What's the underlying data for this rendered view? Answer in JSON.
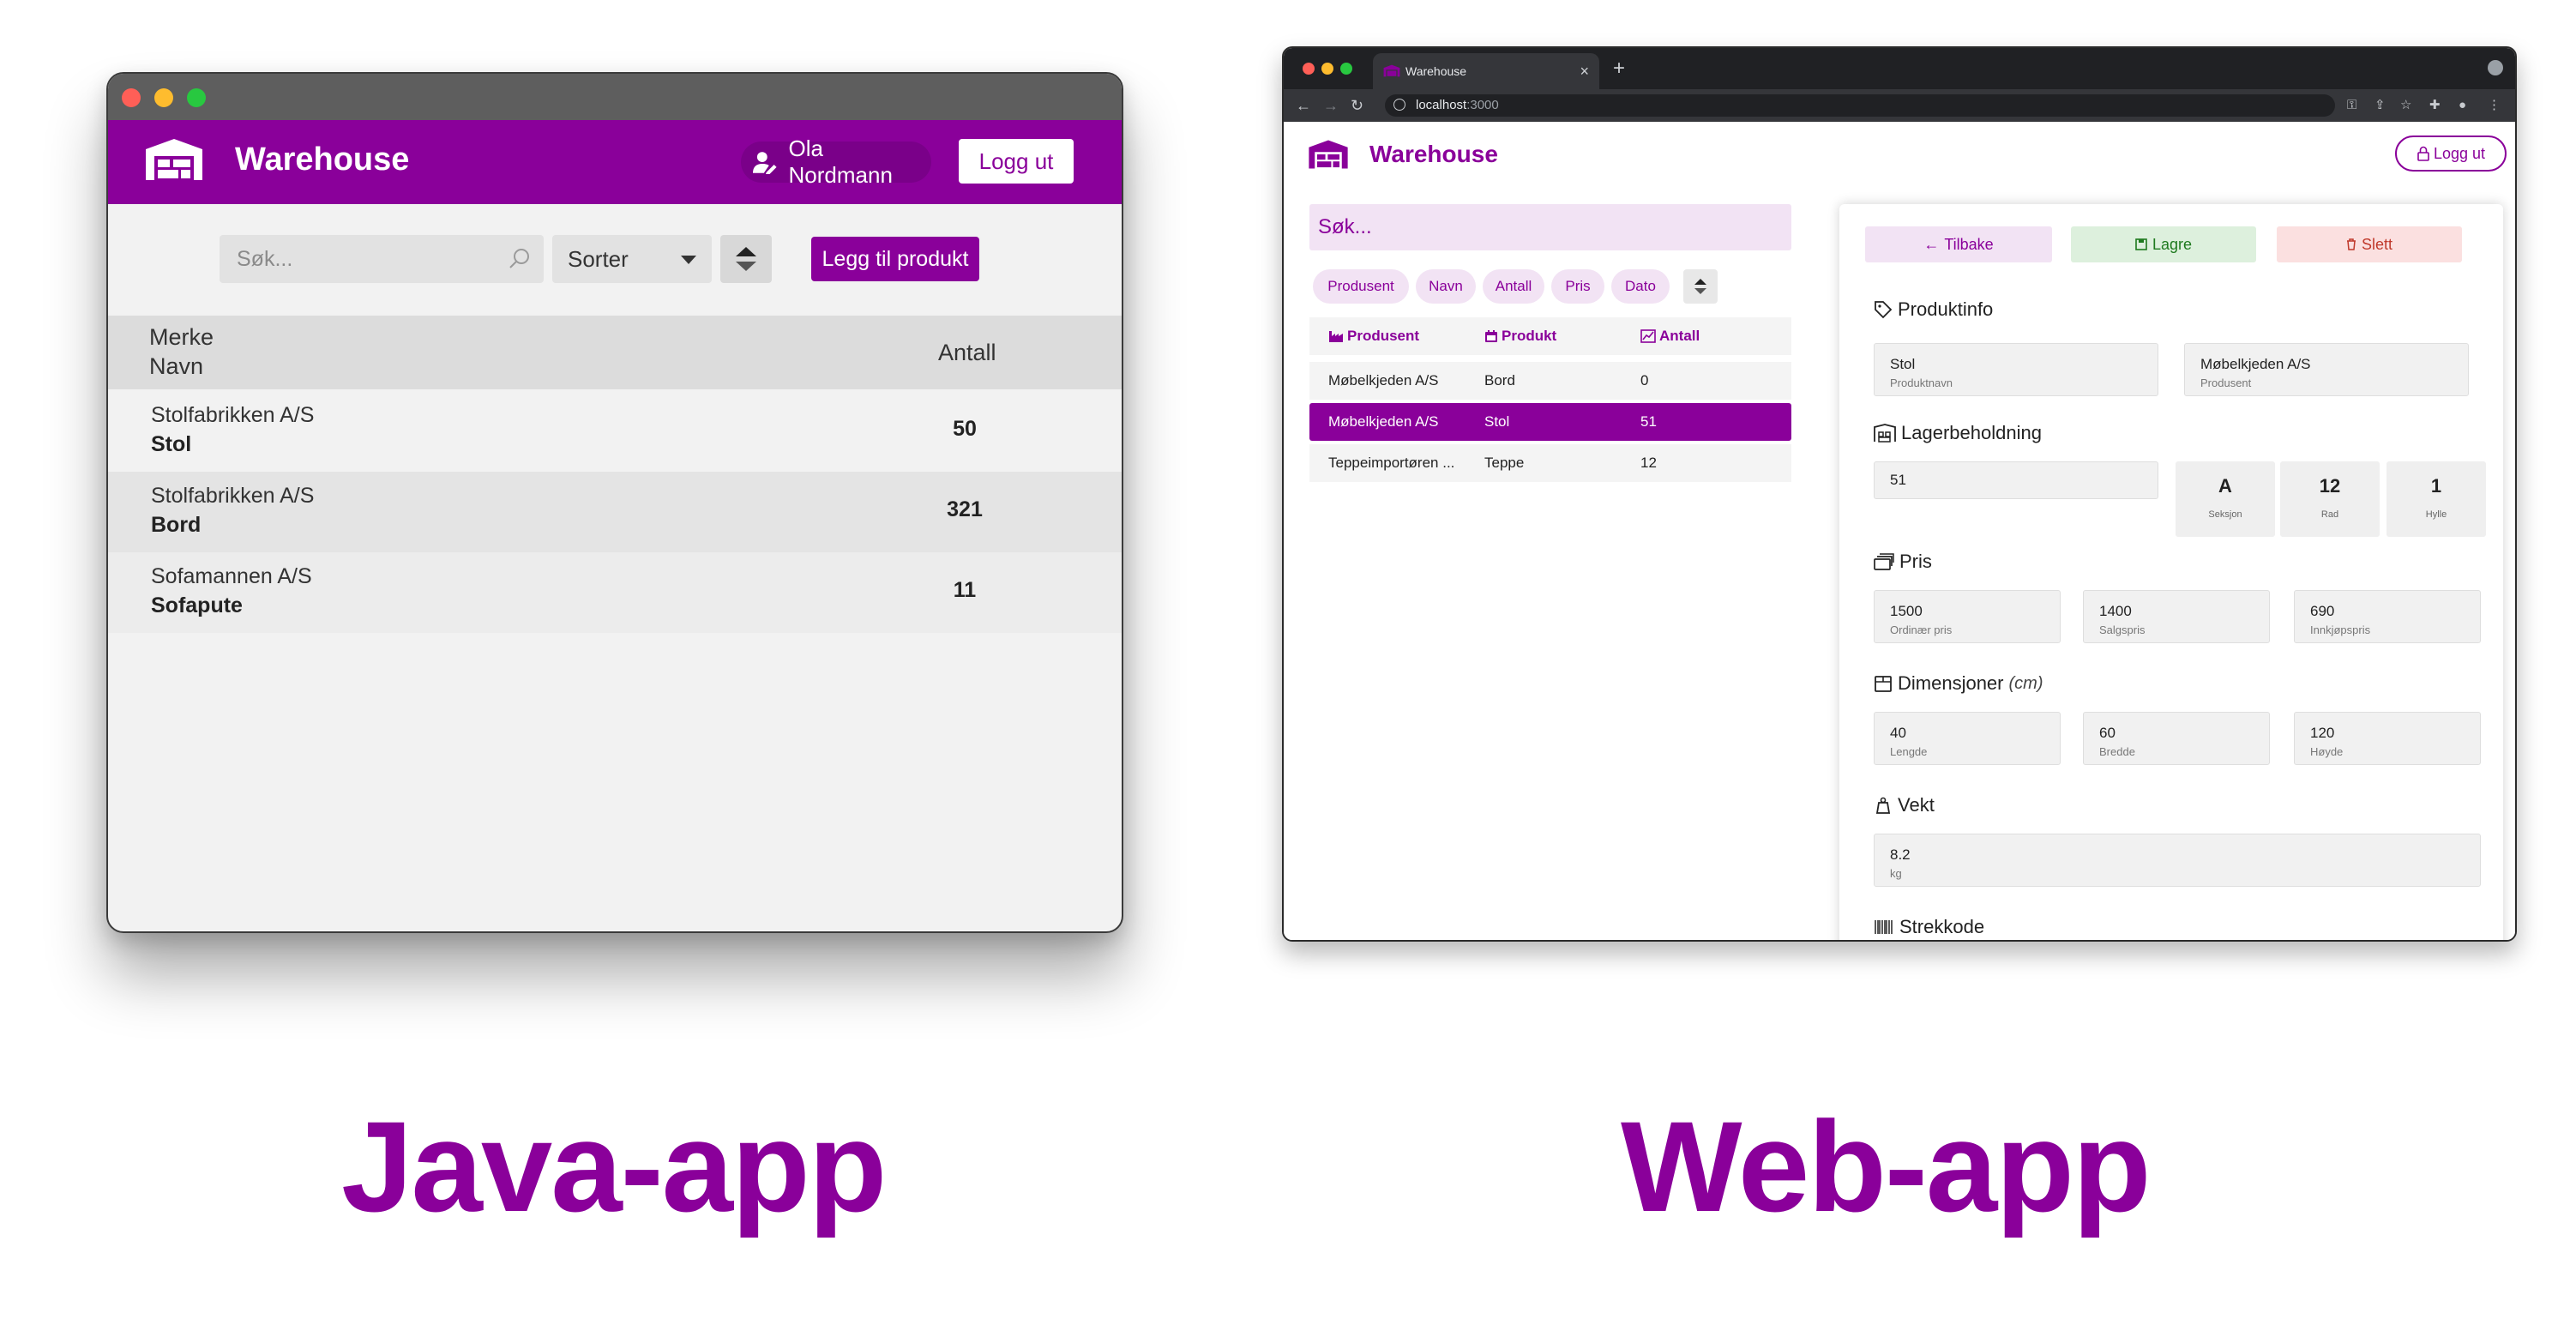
{
  "captions": {
    "left": "Java-app",
    "right": "Web-app"
  },
  "colors": {
    "accent": "#8a009a",
    "accent_light": "#f2e3f4",
    "save_green": "#1f7a1f",
    "delete_red": "#c0392b"
  },
  "java_app": {
    "title": "Warehouse",
    "user": "Ola Nordmann",
    "logout": "Logg ut",
    "search_placeholder": "Søk...",
    "sort_label": "Sorter",
    "add_product": "Legg til produkt",
    "columns": {
      "brand": "Merke",
      "name": "Navn",
      "qty": "Antall"
    },
    "rows": [
      {
        "brand": "Stolfabrikken A/S",
        "name": "Stol",
        "qty": "50"
      },
      {
        "brand": "Stolfabrikken A/S",
        "name": "Bord",
        "qty": "321"
      },
      {
        "brand": "Sofamannen A/S",
        "name": "Sofapute",
        "qty": "11"
      }
    ]
  },
  "browser": {
    "tab_title": "Warehouse",
    "url_host": "localhost",
    "url_port": ":3000"
  },
  "web_app": {
    "title": "Warehouse",
    "logout": "Logg ut",
    "search_placeholder": "Søk...",
    "chips": [
      "Produsent",
      "Navn",
      "Antall",
      "Pris",
      "Dato"
    ],
    "columns": {
      "producer": "Produsent",
      "product": "Produkt",
      "qty": "Antall"
    },
    "rows": [
      {
        "producer": "Møbelkjeden A/S",
        "product": "Bord",
        "qty": "0"
      },
      {
        "producer": "Møbelkjeden A/S",
        "product": "Stol",
        "qty": "51"
      },
      {
        "producer": "Teppeimportøren ...",
        "product": "Teppe",
        "qty": "12"
      }
    ],
    "selected_row": 1,
    "detail": {
      "back": "Tilbake",
      "save": "Lagre",
      "delete": "Slett",
      "product_info": {
        "heading": "Produktinfo",
        "name": {
          "value": "Stol",
          "label": "Produktnavn"
        },
        "producer": {
          "value": "Møbelkjeden A/S",
          "label": "Produsent"
        }
      },
      "stock": {
        "heading": "Lagerbeholdning",
        "value": "51",
        "section": {
          "value": "A",
          "label": "Seksjon"
        },
        "row": {
          "value": "12",
          "label": "Rad"
        },
        "shelf": {
          "value": "1",
          "label": "Hylle"
        }
      },
      "price": {
        "heading": "Pris",
        "regular": {
          "value": "1500",
          "label": "Ordinær pris"
        },
        "sale": {
          "value": "1400",
          "label": "Salgspris"
        },
        "purchase": {
          "value": "690",
          "label": "Innkjøpspris"
        }
      },
      "dimensions": {
        "heading": "Dimensjoner",
        "unit": "(cm)",
        "length": {
          "value": "40",
          "label": "Lengde"
        },
        "width": {
          "value": "60",
          "label": "Bredde"
        },
        "height": {
          "value": "120",
          "label": "Høyde"
        }
      },
      "weight": {
        "heading": "Vekt",
        "value": "8.2",
        "unit": "kg"
      },
      "barcode_heading": "Strekkode"
    }
  }
}
